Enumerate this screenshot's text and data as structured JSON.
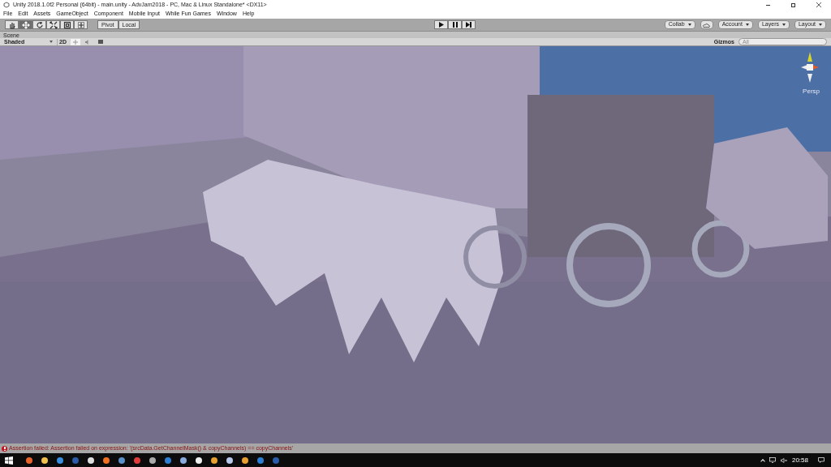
{
  "window": {
    "title": "Unity 2018.1.0f2 Personal (64bit) - main.unity - AdvJam2018 - PC, Mac & Linux Standalone* <DX11>"
  },
  "menu": [
    "File",
    "Edit",
    "Assets",
    "GameObject",
    "Component",
    "Mobile Input",
    "While Fun Games",
    "Window",
    "Help"
  ],
  "tools": [
    {
      "kind": "hand",
      "selected": false
    },
    {
      "kind": "move",
      "selected": true
    },
    {
      "kind": "rotate",
      "selected": false
    },
    {
      "kind": "scale",
      "selected": false
    },
    {
      "kind": "rect",
      "selected": false
    },
    {
      "kind": "transform",
      "selected": false
    }
  ],
  "pivot": {
    "pivot": "Pivot",
    "space": "Local"
  },
  "right_buttons": [
    {
      "kind": "dropdown",
      "label": "Collab"
    },
    {
      "kind": "cloud"
    },
    {
      "kind": "dropdown",
      "label": "Account"
    },
    {
      "kind": "dropdown",
      "label": "Layers"
    },
    {
      "kind": "dropdown",
      "label": "Layout"
    }
  ],
  "scene": {
    "tab": "Scene",
    "shading": "Shaded",
    "mode_2d": "2D",
    "lighting_on": true,
    "audio_on": false,
    "gizmos": "Gizmos",
    "search_placeholder": "All",
    "view_label": "Persp"
  },
  "status_bar": {
    "message": "Assertion failed: Assertion failed on expression: '(srcData.GetChannelMask() & copyChannels) == copyChannels'"
  },
  "taskbar": {
    "clock": "20:58"
  }
}
